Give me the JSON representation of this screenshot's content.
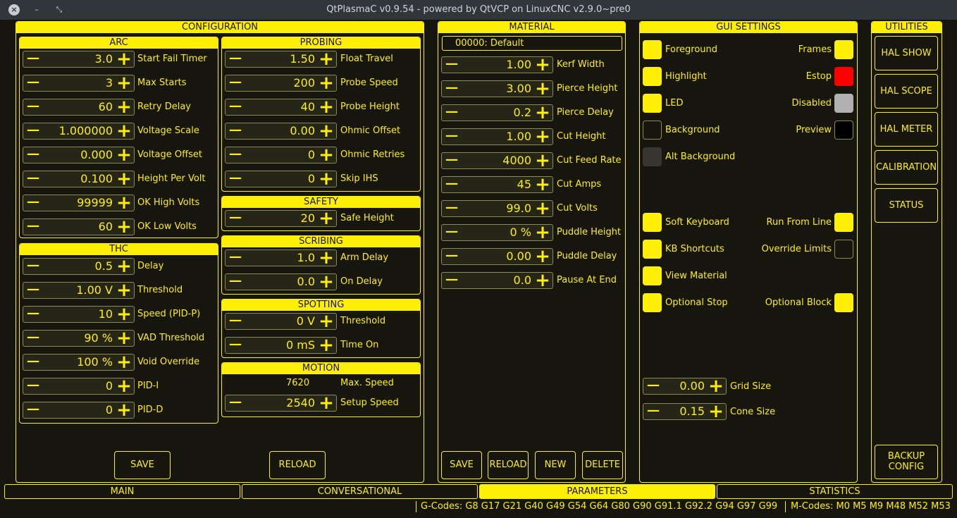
{
  "window": {
    "title": "QtPlasmaC v0.9.54 - powered by QtVCP on LinuxCNC v2.9.0~pre0"
  },
  "configuration": {
    "title": "CONFIGURATION",
    "arc": {
      "title": "ARC",
      "rows": [
        {
          "value": "3.0",
          "label": "Start Fail Timer"
        },
        {
          "value": "3",
          "label": "Max Starts"
        },
        {
          "value": "60",
          "label": "Retry Delay"
        },
        {
          "value": "1.000000",
          "label": "Voltage Scale"
        },
        {
          "value": "0.000",
          "label": "Voltage Offset"
        },
        {
          "value": "0.100",
          "label": "Height Per Volt"
        },
        {
          "value": "99999",
          "label": "OK High Volts"
        },
        {
          "value": "60",
          "label": "OK Low Volts"
        }
      ]
    },
    "thc": {
      "title": "THC",
      "rows": [
        {
          "value": "0.5",
          "label": "Delay"
        },
        {
          "value": "1.00 V",
          "label": "Threshold"
        },
        {
          "value": "10",
          "label": "Speed (PID-P)"
        },
        {
          "value": "90 %",
          "label": "VAD Threshold"
        },
        {
          "value": "100 %",
          "label": "Void Override"
        },
        {
          "value": "0",
          "label": "PID-I"
        },
        {
          "value": "0",
          "label": "PID-D"
        }
      ]
    },
    "probing": {
      "title": "PROBING",
      "rows": [
        {
          "value": "1.50",
          "label": "Float Travel"
        },
        {
          "value": "200",
          "label": "Probe Speed"
        },
        {
          "value": "40",
          "label": "Probe Height"
        },
        {
          "value": "0.00",
          "label": "Ohmic Offset"
        },
        {
          "value": "0",
          "label": "Ohmic Retries"
        },
        {
          "value": "0",
          "label": "Skip IHS"
        }
      ]
    },
    "safety": {
      "title": "SAFETY",
      "rows": [
        {
          "value": "20",
          "label": "Safe Height"
        }
      ]
    },
    "scribing": {
      "title": "SCRIBING",
      "rows": [
        {
          "value": "1.0",
          "label": "Arm Delay"
        },
        {
          "value": "0.0",
          "label": "On Delay"
        }
      ]
    },
    "spotting": {
      "title": "SPOTTING",
      "rows": [
        {
          "value": "0 V",
          "label": "Threshold"
        },
        {
          "value": "0 mS",
          "label": "Time On"
        }
      ]
    },
    "motion": {
      "title": "MOTION",
      "max_speed_value": "7620",
      "max_speed_label": "Max. Speed",
      "rows": [
        {
          "value": "2540",
          "label": "Setup Speed"
        }
      ]
    },
    "save_label": "SAVE",
    "reload_label": "RELOAD"
  },
  "material": {
    "title": "MATERIAL",
    "selected": "00000: Default",
    "rows": [
      {
        "value": "1.00",
        "label": "Kerf Width"
      },
      {
        "value": "3.00",
        "label": "Pierce Height"
      },
      {
        "value": "0.2",
        "label": "Pierce Delay"
      },
      {
        "value": "1.00",
        "label": "Cut Height"
      },
      {
        "value": "4000",
        "label": "Cut Feed Rate"
      },
      {
        "value": "45",
        "label": "Cut Amps"
      },
      {
        "value": "99.0",
        "label": "Cut Volts"
      },
      {
        "value": "0 %",
        "label": "Puddle Height"
      },
      {
        "value": "0.00",
        "label": "Puddle Delay"
      },
      {
        "value": "0.0",
        "label": "Pause At End"
      }
    ],
    "buttons": [
      "SAVE",
      "RELOAD",
      "NEW",
      "DELETE"
    ]
  },
  "gui_settings": {
    "title": "GUI SETTINGS",
    "colors_left": [
      {
        "label": "Foreground",
        "color": "#ffee06"
      },
      {
        "label": "Highlight",
        "color": "#ffee06"
      },
      {
        "label": "LED",
        "color": "#ffee06"
      },
      {
        "label": "Background",
        "color": "#16160f"
      },
      {
        "label": "Alt Background",
        "color": "#36362f"
      }
    ],
    "colors_right": [
      {
        "label": "Frames",
        "color": "#ffee06"
      },
      {
        "label": "Estop",
        "color": "#ff0000"
      },
      {
        "label": "Disabled",
        "color": "#b0b0b0"
      },
      {
        "label": "Preview",
        "color": "#000000"
      }
    ],
    "options_left": [
      {
        "label": "Soft Keyboard",
        "checked": true
      },
      {
        "label": "KB Shortcuts",
        "checked": true
      },
      {
        "label": "View Material",
        "checked": true
      },
      {
        "label": "Optional Stop",
        "checked": true
      }
    ],
    "options_right": [
      {
        "label": "Run From Line",
        "checked": true
      },
      {
        "label": "Override Limits",
        "checked": false
      },
      {
        "label": "Optional Block",
        "checked": true
      }
    ],
    "grid": {
      "value": "0.00",
      "label": "Grid Size"
    },
    "cone": {
      "value": "0.15",
      "label": "Cone Size"
    }
  },
  "utilities": {
    "title": "UTILITIES",
    "buttons": [
      "HAL SHOW",
      "HAL SCOPE",
      "HAL METER",
      "CALIBRATION",
      "STATUS"
    ],
    "backup": [
      "BACKUP",
      "CONFIG"
    ]
  },
  "tabs": [
    {
      "label": "MAIN",
      "active": false
    },
    {
      "label": "CONVERSATIONAL",
      "active": false
    },
    {
      "label": "PARAMETERS",
      "active": true
    },
    {
      "label": "STATISTICS",
      "active": false
    }
  ],
  "statusbar": {
    "gcodes": "G-Codes: G8 G17 G21 G40 G49 G54 G64 G80 G90 G91.1 G92.2 G94 G97 G99",
    "mcodes": "M-Codes: M0 M5 M9 M48 M52 M53"
  },
  "colors": {
    "accent": "#ffee06",
    "background": "#16160f",
    "estop": "#ff0000"
  }
}
